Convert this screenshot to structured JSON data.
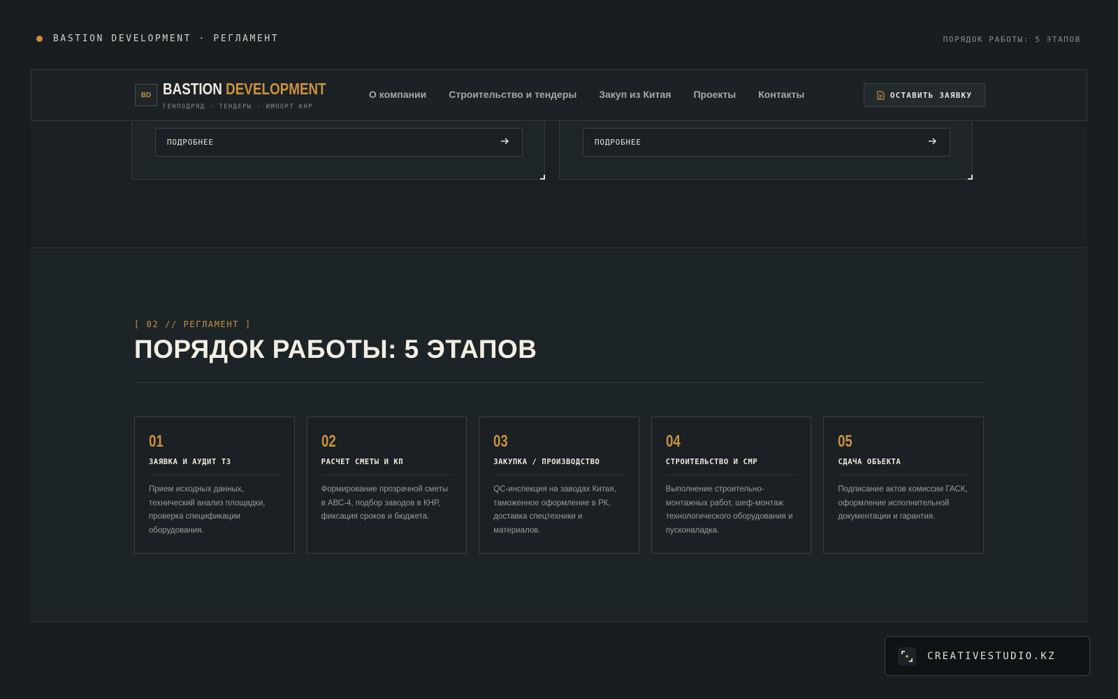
{
  "topbar": {
    "brand_line": "BASTION DEVELOPMENT · РЕГЛАМЕНТ",
    "right_line": "ПОРЯДОК РАБОТЫ: 5 ЭТАПОВ"
  },
  "header": {
    "logo_mark": "BD",
    "logo_name_main": "BASTION",
    "logo_name_accent": "DEVELOPMENT",
    "logo_sub": "ГЕНПОДРЯД · ТЕНДЕРЫ · ИМПОРТ КНР",
    "nav": [
      {
        "label": "О компании"
      },
      {
        "label": "Строительство и тендеры"
      },
      {
        "label": "Закуп из Китая"
      },
      {
        "label": "Проекты"
      },
      {
        "label": "Контакты"
      }
    ],
    "cta_label": "ОСТАВИТЬ ЗАЯВКУ"
  },
  "upper_cards": [
    {
      "more_label": "ПОДРОБНЕЕ"
    },
    {
      "more_label": "ПОДРОБНЕЕ"
    }
  ],
  "process": {
    "eyebrow": "[ 02 // РЕГЛАМЕНТ ]",
    "title": "ПОРЯДОК РАБОТЫ: 5 ЭТАПОВ",
    "steps": [
      {
        "num": "01",
        "title": "ЗАЯВКА И АУДИТ ТЗ",
        "text": "Прием исходных данных, технический анализ площадки, проверка спецификации оборудования."
      },
      {
        "num": "02",
        "title": "РАСЧЕТ СМЕТЫ И КП",
        "text": "Формирование прозрачной сметы в АВС-4, подбор заводов в КНР, фиксация сроков и бюджета."
      },
      {
        "num": "03",
        "title": "ЗАКУПКА / ПРОИЗВОДСТВО",
        "text": "QC-инспекция на заводах Китая, таможенное оформление в РК, доставка спецтехники и материалов."
      },
      {
        "num": "04",
        "title": "СТРОИТЕЛЬСТВО И СМР",
        "text": "Выполнение строительно-монтажных работ, шеф-монтаж технологического оборудования и пусконаладка."
      },
      {
        "num": "05",
        "title": "СДАЧА ОБЪЕКТА",
        "text": "Подписание актов комиссии ГАСК, оформление исполнительной документации и гарантия."
      }
    ]
  },
  "badge": {
    "label": "CREATIVESTUDIO.KZ"
  },
  "colors": {
    "accent": "#c8913e",
    "background": "#181d20",
    "panel": "#1d2427"
  },
  "icons": {
    "cta": "document-icon",
    "more": "arrow-right-icon",
    "badge": "focus-corners-icon"
  }
}
